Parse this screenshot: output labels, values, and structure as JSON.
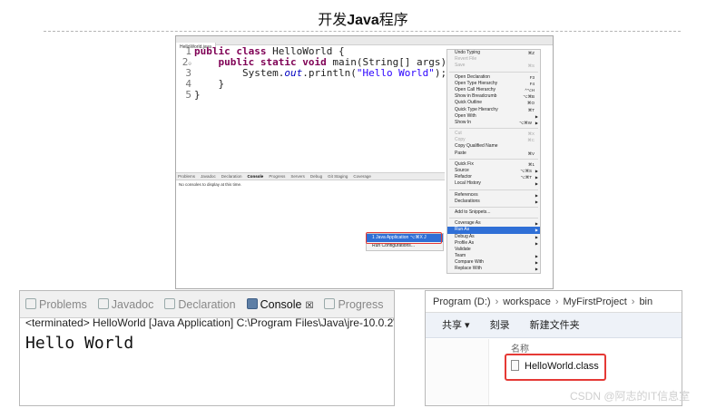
{
  "slide": {
    "title_prefix": "开发",
    "title_bold": "Java",
    "title_suffix": "程序"
  },
  "ide": {
    "editor_tab": "HelloWorld.java",
    "code_lines": [
      {
        "n": "1",
        "marker": ""
      },
      {
        "n": "2",
        "marker": "⊖"
      },
      {
        "n": "3",
        "marker": ""
      },
      {
        "n": "4",
        "marker": ""
      },
      {
        "n": "5",
        "marker": ""
      }
    ],
    "lower_tabs": [
      "Problems",
      "Javadoc",
      "Declaration",
      "Console",
      "Progress",
      "Servers",
      "Debug",
      "Git Staging",
      "Coverage"
    ],
    "no_console_text": "No consoles to display at this time.",
    "context_menu": [
      {
        "label": "Undo Typing",
        "shortcut": "⌘Z",
        "state": ""
      },
      {
        "label": "Revert File",
        "shortcut": "",
        "state": "disabled"
      },
      {
        "label": "Save",
        "shortcut": "⌘S",
        "state": "disabled"
      },
      {
        "sep": true
      },
      {
        "label": "Open Declaration",
        "shortcut": "F3",
        "state": ""
      },
      {
        "label": "Open Type Hierarchy",
        "shortcut": "F4",
        "state": ""
      },
      {
        "label": "Open Call Hierarchy",
        "shortcut": "^⌥H",
        "state": ""
      },
      {
        "label": "Show in Breadcrumb",
        "shortcut": "⌥⌘B",
        "state": ""
      },
      {
        "label": "Quick Outline",
        "shortcut": "⌘O",
        "state": ""
      },
      {
        "label": "Quick Type Hierarchy",
        "shortcut": "⌘T",
        "state": ""
      },
      {
        "label": "Open With",
        "shortcut": "",
        "arrow": true,
        "state": ""
      },
      {
        "label": "Show In",
        "shortcut": "⌥⌘W",
        "arrow": true,
        "state": ""
      },
      {
        "sep": true
      },
      {
        "label": "Cut",
        "shortcut": "⌘X",
        "state": "disabled"
      },
      {
        "label": "Copy",
        "shortcut": "⌘C",
        "state": "disabled"
      },
      {
        "label": "Copy Qualified Name",
        "shortcut": "",
        "state": ""
      },
      {
        "label": "Paste",
        "shortcut": "⌘V",
        "state": ""
      },
      {
        "sep": true
      },
      {
        "label": "Quick Fix",
        "shortcut": "⌘1",
        "state": ""
      },
      {
        "label": "Source",
        "shortcut": "⌥⌘S",
        "arrow": true,
        "state": ""
      },
      {
        "label": "Refactor",
        "shortcut": "⌥⌘T",
        "arrow": true,
        "state": ""
      },
      {
        "label": "Local History",
        "shortcut": "",
        "arrow": true,
        "state": ""
      },
      {
        "sep": true
      },
      {
        "label": "References",
        "shortcut": "",
        "arrow": true,
        "state": ""
      },
      {
        "label": "Declarations",
        "shortcut": "",
        "arrow": true,
        "state": ""
      },
      {
        "sep": true
      },
      {
        "label": "Add to Snippets...",
        "shortcut": "",
        "state": ""
      },
      {
        "sep": true
      },
      {
        "label": "Coverage As",
        "shortcut": "",
        "arrow": true,
        "state": ""
      },
      {
        "label": "Run As",
        "shortcut": "",
        "arrow": true,
        "state": "selected"
      },
      {
        "label": "Debug As",
        "shortcut": "",
        "arrow": true,
        "state": ""
      },
      {
        "label": "Profile As",
        "shortcut": "",
        "arrow": true,
        "state": ""
      },
      {
        "label": "Validate",
        "shortcut": "",
        "state": ""
      },
      {
        "label": "Team",
        "shortcut": "",
        "arrow": true,
        "state": ""
      },
      {
        "label": "Compare With",
        "shortcut": "",
        "arrow": true,
        "state": ""
      },
      {
        "label": "Replace With",
        "shortcut": "",
        "arrow": true,
        "state": ""
      }
    ],
    "submenu": [
      {
        "label": "1 Java Application ⌥⌘X J",
        "state": "selected"
      },
      {
        "label": "Run Configurations...",
        "state": ""
      }
    ]
  },
  "console": {
    "tabs": [
      {
        "label": "Problems",
        "active": false
      },
      {
        "label": "Javadoc",
        "active": false
      },
      {
        "label": "Declaration",
        "active": false
      },
      {
        "label": "Console",
        "active": true,
        "close": "☒"
      },
      {
        "label": "Progress",
        "active": false
      }
    ],
    "status": "<terminated> HelloWorld [Java Application] C:\\Program Files\\Java\\jre-10.0.2\\",
    "output": "Hello World"
  },
  "explorer": {
    "path": [
      "Program (D:)",
      "workspace",
      "MyFirstProject",
      "bin"
    ],
    "toolbar": [
      "共享 ▾",
      "刻录",
      "新建文件夹"
    ],
    "column_name": "名称",
    "file_name": "HelloWorld.class"
  },
  "watermark": "CSDN @阿志的IT信息室",
  "colors": {
    "highlight_blue": "#2f6fd6",
    "annotation_red": "#e53935",
    "keyword": "#7f0055",
    "string": "#2a00ff"
  }
}
